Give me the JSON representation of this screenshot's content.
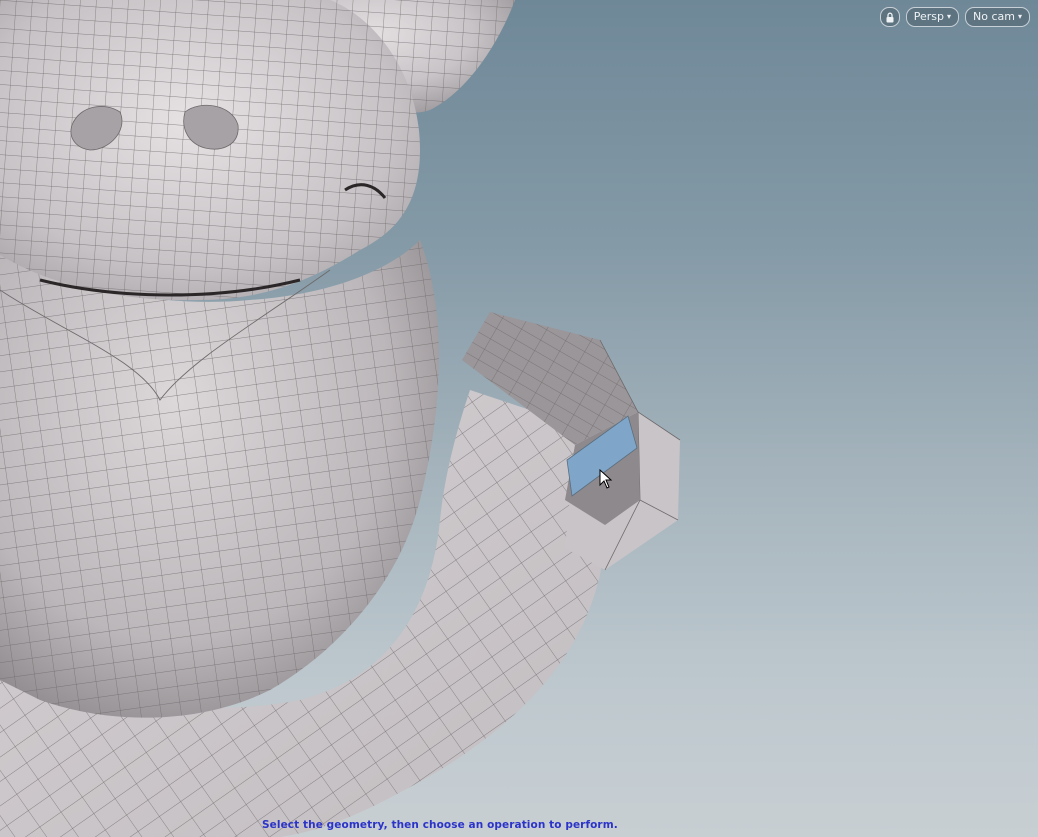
{
  "viewport": {
    "lock_icon": "lock-icon",
    "view_menu_label": "Persp",
    "camera_menu_label": "No cam",
    "dropdown_icon": "caret-down-icon"
  },
  "status": {
    "prompt": "Select the geometry, then choose an operation to perform."
  },
  "colors": {
    "background_top": "#6f8898",
    "background_bottom": "#c8cfd3",
    "mesh_surface": "#cbc6c9",
    "wireframe": "#6b6668",
    "selected_face": "#7fa6c9",
    "status_text": "#2b33c9"
  }
}
